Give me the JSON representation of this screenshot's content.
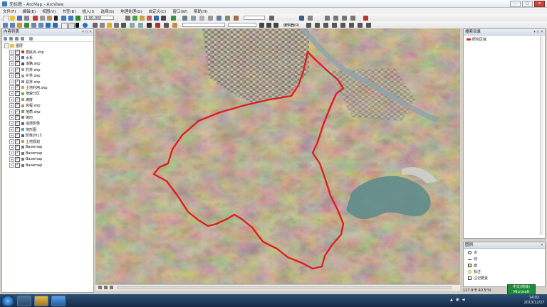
{
  "window": {
    "title": "无标题 - ArcMap - ArcView"
  },
  "menu": [
    "文件(F)",
    "编辑(E)",
    "视图(V)",
    "书签(B)",
    "插入(I)",
    "选择(S)",
    "地理处理(G)",
    "自定义(C)",
    "窗口(W)",
    "帮助(H)"
  ],
  "toolbar": {
    "scale": "1:90,000",
    "editor": "编辑器(R)"
  },
  "toc": {
    "title": "内容列表",
    "root": "图层",
    "items": [
      "居民点.shp",
      "水系",
      "道路.shp",
      "村界.shp",
      "乡界.shp",
      "县界.shp",
      "土地利用.shp",
      "地貌分区",
      "坡度",
      "高程.shp",
      "地质.shp",
      "坡向",
      "遥感影像",
      "地形图",
      "影像2013",
      "土地规划",
      "Basemap",
      "Basemap",
      "Basemap",
      "Basemap"
    ]
  },
  "catalog": {
    "title": "搜索目录",
    "item": "研究区域"
  },
  "legend": {
    "title": "图例",
    "items": [
      "点",
      "线",
      "面",
      "标注",
      "注记要素"
    ]
  },
  "status": {
    "coords": "117.9°E 40.5°N",
    "badge_line1": "中文(简体)",
    "badge_line2": "Microsoft"
  },
  "taskbar": {
    "time": "14:02",
    "date": "2013/12/27"
  },
  "colors": {
    "boundary": "#e01e1e",
    "water": "#5f8c8a",
    "river": "#8fa5ad"
  }
}
